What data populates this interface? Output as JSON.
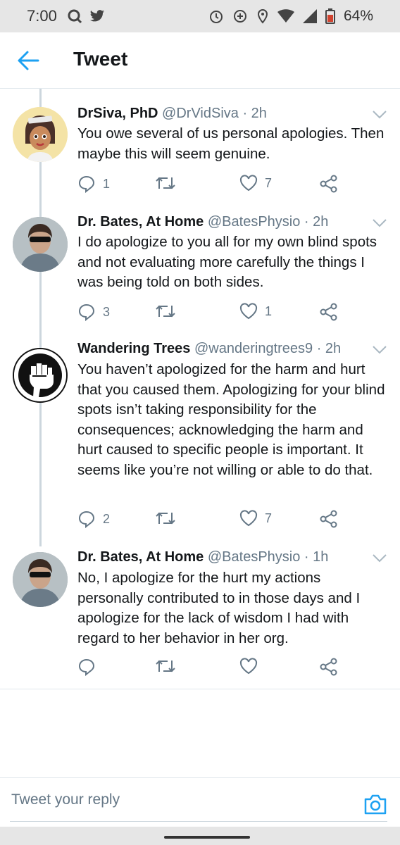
{
  "status_bar": {
    "time": "7:00",
    "left_icons": [
      "q-icon",
      "twitter-bird-icon"
    ],
    "right_icons": [
      "alarm-icon",
      "data-saver-icon",
      "location-icon",
      "wifi-icon",
      "signal-icon",
      "battery-icon"
    ],
    "battery": "64%"
  },
  "header": {
    "title": "Tweet"
  },
  "tweets": [
    {
      "name": "DrSiva, PhD",
      "handle": "@DrVidSiva · 2h",
      "text": "You owe several of us personal apologies. Then maybe this will seem genuine.",
      "replies": "1",
      "retweets": "",
      "likes": "7"
    },
    {
      "name": "Dr. Bates, At Home",
      "handle": "@BatesPhysio · 2h",
      "text": "I do apologize to you all for my own blind spots and not evaluating more carefully the things I was being told on both sides.",
      "replies": "3",
      "retweets": "",
      "likes": "1"
    },
    {
      "name": "Wandering Trees",
      "handle": "@wanderingtrees9 · 2h",
      "text": "You haven’t apologized for the harm and hurt that you caused them. Apologizing for your blind spots isn’t taking responsibility for the consequences; acknowledging the harm and hurt caused to specific people is important. It seems like you’re not willing or able to do that.",
      "replies": "2",
      "retweets": "",
      "likes": "7"
    },
    {
      "name": "Dr. Bates, At Home",
      "handle": "@BatesPhysio · 1h",
      "text": "No, I apologize for the hurt  my actions personally contributed to in those days and I apologize for the lack of wisdom I had with regard to her behavior in her org.",
      "replies": "",
      "retweets": "",
      "likes": ""
    }
  ],
  "reply": {
    "placeholder": "Tweet your reply"
  },
  "colors": {
    "accent": "#1da1f2",
    "icon_gray": "#657786",
    "divider": "#e1e8ed",
    "status_bar_bg": "#e6e6e6"
  }
}
